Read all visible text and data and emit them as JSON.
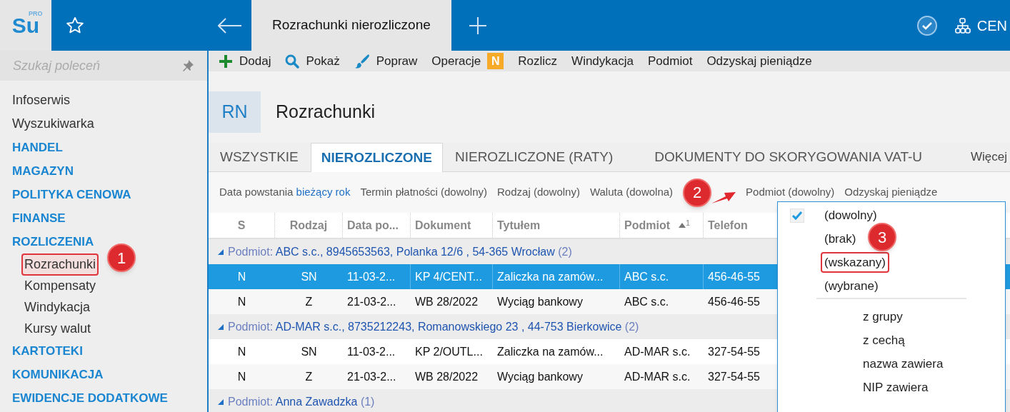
{
  "app": {
    "logo": "Su",
    "logo_badge": "PRO"
  },
  "top_tabs": [
    {
      "label": "Rozrachunki nierozliczone",
      "selected": true
    }
  ],
  "user": {
    "label": "CEN"
  },
  "command_search": {
    "placeholder": "Szukaj poleceń"
  },
  "sidebar": {
    "items": [
      {
        "label": "Infoserwis",
        "kind": "link"
      },
      {
        "label": "Wyszukiwarka",
        "kind": "link"
      },
      {
        "label": "HANDEL",
        "kind": "section"
      },
      {
        "label": "MAGAZYN",
        "kind": "section"
      },
      {
        "label": "POLITYKA CENOWA",
        "kind": "section"
      },
      {
        "label": "FINANSE",
        "kind": "section"
      },
      {
        "label": "ROZLICZENIA",
        "kind": "section",
        "children": [
          {
            "label": "Rozrachunki",
            "highlighted": true
          },
          {
            "label": "Kompensaty",
            "highlighted": false
          },
          {
            "label": "Windykacja",
            "highlighted": false
          },
          {
            "label": "Kursy walut",
            "highlighted": false
          }
        ]
      },
      {
        "label": "KARTOTEKI",
        "kind": "section"
      },
      {
        "label": "KOMUNIKACJA",
        "kind": "section"
      },
      {
        "label": "EWIDENCJE DODATKOWE",
        "kind": "section"
      }
    ]
  },
  "toolbar": [
    {
      "label": "Dodaj",
      "kind": "add"
    },
    {
      "label": "Pokaż",
      "kind": "search"
    },
    {
      "label": "Popraw",
      "kind": "edit"
    },
    {
      "label": "Operacje",
      "kind": "menu",
      "badge": "N"
    },
    {
      "label": "Rozlicz",
      "kind": "plain"
    },
    {
      "label": "Windykacja",
      "kind": "plain"
    },
    {
      "label": "Podmiot",
      "kind": "plain"
    },
    {
      "label": "Odzyskaj pieniądze",
      "kind": "plain"
    }
  ],
  "header": {
    "code": "RN",
    "title": "Rozrachunki"
  },
  "tabs": [
    {
      "label": "WSZYSTKIE",
      "selected": false
    },
    {
      "label": "NIEROZLICZONE",
      "selected": true
    },
    {
      "label": "NIEROZLICZONE (RATY)",
      "selected": false
    },
    {
      "label": "DOKUMENTY DO SKORYGOWANIA VAT-U",
      "selected": false
    }
  ],
  "tabs_more": "Więcej",
  "filters": [
    {
      "label": "Data powstania",
      "value": "bieżący rok"
    },
    {
      "label": "Termin płatności (dowolny)"
    },
    {
      "label": "Rodzaj (dowolny)"
    },
    {
      "label": "Waluta (dowolna)"
    },
    {
      "label": "Podmiot (dowolny)"
    },
    {
      "label": "Odzyskaj pieniądze"
    }
  ],
  "table": {
    "columns": [
      {
        "label": "S"
      },
      {
        "label": "Rodzaj"
      },
      {
        "label": "Data po..."
      },
      {
        "label": "Dokument"
      },
      {
        "label": "Tytułem"
      },
      {
        "label": "Podmiot",
        "sort": "1"
      },
      {
        "label": "Telefon"
      }
    ],
    "groups": [
      {
        "label": "Podmiot:",
        "value": "ABC s.c., 8945653563, Polanka  12/6 , 54-365 Wrocław",
        "count": "(2)",
        "expanded": true,
        "rows": [
          {
            "selected": true,
            "cells": [
              "N",
              "SN",
              "11-03-2...",
              "KP 4/CENT...",
              "Zaliczka na zamów...",
              "ABC s.c.",
              "456-46-55"
            ]
          },
          {
            "selected": false,
            "cells": [
              "N",
              "Z",
              "21-03-2...",
              "WB 28/2022",
              "Wyciąg bankowy",
              "ABC s.c.",
              "456-46-55"
            ]
          }
        ]
      },
      {
        "label": "Podmiot:",
        "value": "AD-MAR s.c., 8735212243, Romanowskiego 23 , 44-753 Bierkowice",
        "count": "(2)",
        "expanded": true,
        "rows": [
          {
            "selected": false,
            "cells": [
              "N",
              "SN",
              "11-03-2...",
              "KP 2/OUTL...",
              "Zaliczka na zamów...",
              "AD-MAR s.c.",
              "327-54-55"
            ]
          },
          {
            "selected": false,
            "cells": [
              "N",
              "Z",
              "21-03-2...",
              "WB 28/2022",
              "Wyciąg bankowy",
              "AD-MAR s.c.",
              "327-54-55"
            ]
          }
        ]
      },
      {
        "label": "Podmiot:",
        "value": "Anna Zawadzka",
        "count": "(1)",
        "expanded": true
      }
    ]
  },
  "dropdown": {
    "groups": [
      [
        {
          "label": "(dowolny)",
          "checked": true,
          "highlighted": false
        },
        {
          "label": "(brak)",
          "checked": false,
          "highlighted": false
        },
        {
          "label": "(wskazany)",
          "checked": false,
          "highlighted": true
        },
        {
          "label": "(wybrane)",
          "checked": false,
          "highlighted": false
        }
      ],
      [
        {
          "label": "z grupy",
          "checked": false,
          "highlighted": false
        },
        {
          "label": "z cechą",
          "checked": false,
          "highlighted": false
        },
        {
          "label": "nazwa zawiera",
          "checked": false,
          "highlighted": false
        },
        {
          "label": "NIP zawiera",
          "checked": false,
          "highlighted": false
        }
      ]
    ]
  },
  "annotations": [
    {
      "label": "1"
    },
    {
      "label": "2"
    },
    {
      "label": "3"
    }
  ]
}
